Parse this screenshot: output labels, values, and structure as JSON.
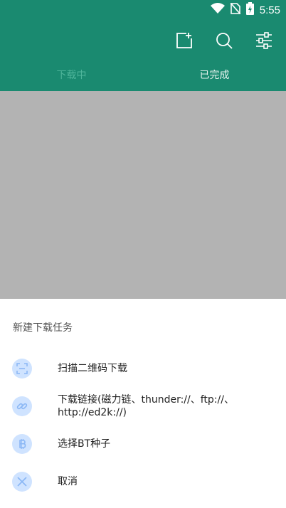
{
  "status_bar": {
    "time": "5:55",
    "icons": [
      "wifi-icon",
      "no-sim-icon",
      "battery-charging-icon"
    ]
  },
  "app_bar": {
    "background_color": "#1a8a70",
    "actions": [
      {
        "name": "add-task-button",
        "icon": "add-box-icon"
      },
      {
        "name": "search-button",
        "icon": "search-icon"
      },
      {
        "name": "filter-button",
        "icon": "sliders-icon"
      }
    ],
    "tabs": [
      {
        "label": "下载中",
        "active": false
      },
      {
        "label": "已完成",
        "active": true
      }
    ]
  },
  "bottom_sheet": {
    "title": "新建下载任务",
    "items": [
      {
        "label": "扫描二维码下载",
        "icon": "scan-icon"
      },
      {
        "label": "下载链接(磁力链、thunder://、ftp://、http://ed2k://)",
        "icon": "link-icon"
      },
      {
        "label": "选择BT种子",
        "icon": "bitcoin-icon"
      },
      {
        "label": "取消",
        "icon": "close-icon"
      }
    ],
    "icon_bg_color": "#cfe3ff",
    "icon_fg_color": "#8cb8f5"
  }
}
